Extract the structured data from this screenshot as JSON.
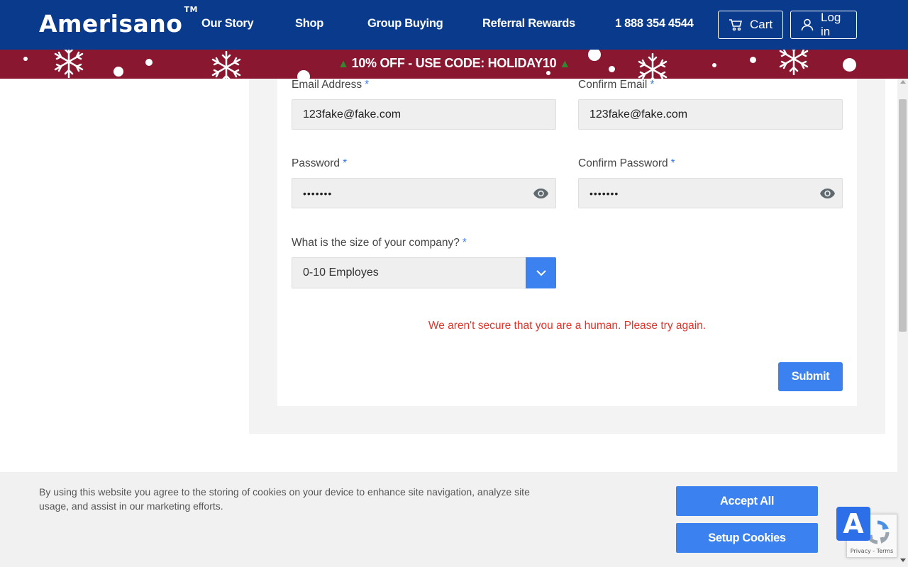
{
  "header": {
    "logo": "Amerisano",
    "logo_mark": "TM",
    "nav": [
      {
        "label": "Our Story"
      },
      {
        "label": "Shop"
      },
      {
        "label": "Group Buying"
      },
      {
        "label": "Referral Rewards"
      },
      {
        "label": "1 888 354 4544"
      }
    ],
    "cart_label": "Cart",
    "cart_icon": "cart-icon",
    "login_label": "Log in",
    "login_icon": "user-icon",
    "bg_color": "#0a3a8c"
  },
  "promo": {
    "text": "10% OFF - USE CODE: HOLIDAY10",
    "bg_color": "#8a1730"
  },
  "form": {
    "email_label": "Email Address",
    "email_value": "123fake@fake.com",
    "confirm_email_label": "Confirm Email",
    "confirm_email_value": "123fake@fake.com",
    "password_label": "Password",
    "password_value": "•••••••",
    "confirm_password_label": "Confirm Password",
    "confirm_password_value": "•••••••",
    "required_mark": "*",
    "company_size_label": "What is the size of your company?",
    "company_size_value": "0-10 Employes",
    "error_message": "We aren't secure that you are a human. Please try again.",
    "submit_label": "Submit",
    "accent_color": "#3b82f0",
    "error_color": "#e0342a"
  },
  "cookie": {
    "text": "By using this website you agree to the storing of cookies on your device to enhance site navigation, analyze site usage, and assist in our marketing efforts.",
    "accept_label": "Accept All",
    "setup_label": "Setup Cookies"
  },
  "recaptcha": {
    "links": "Privacy - Terms"
  },
  "accessibility": {
    "label": "A"
  }
}
